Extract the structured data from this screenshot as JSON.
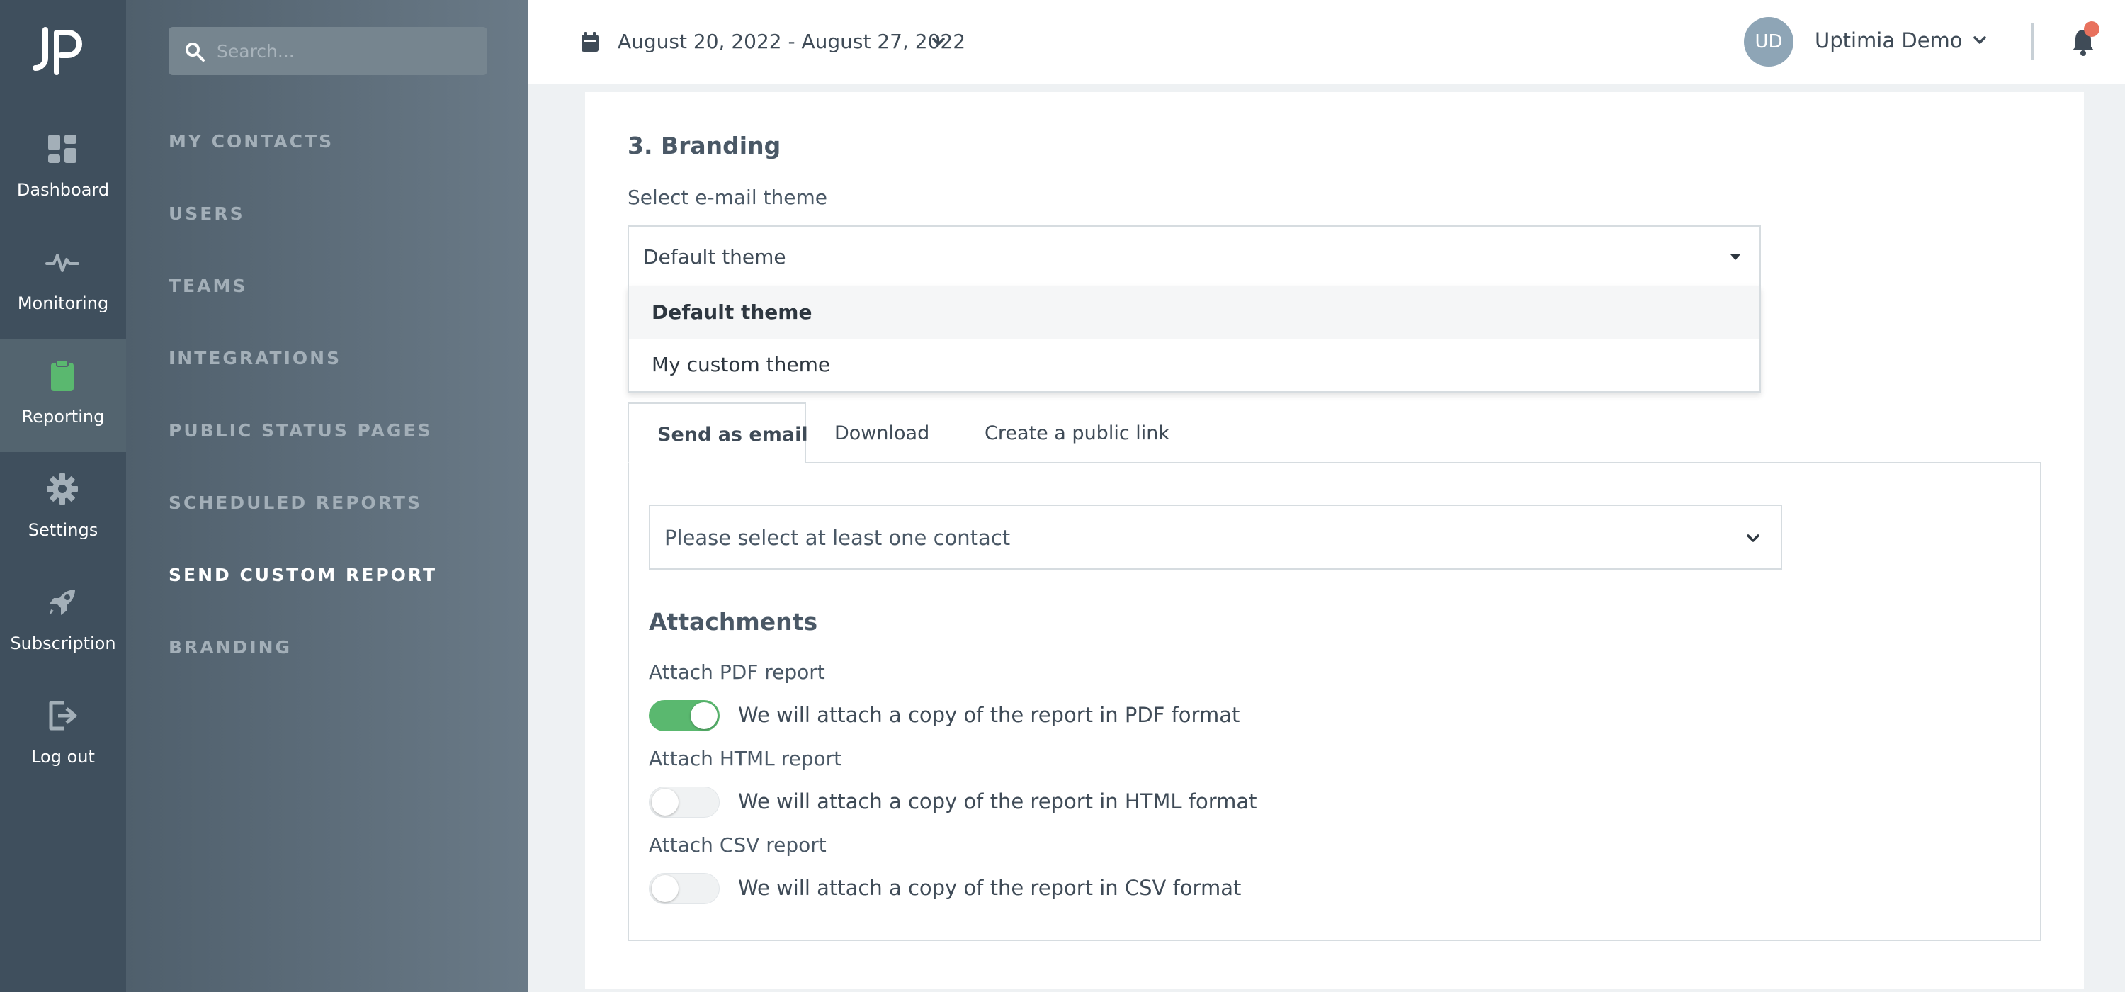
{
  "rail": {
    "items": [
      {
        "label": "Dashboard",
        "icon": "dashboard-icon"
      },
      {
        "label": "Monitoring",
        "icon": "pulse-icon"
      },
      {
        "label": "Reporting",
        "icon": "clipboard-icon",
        "active": true
      },
      {
        "label": "Settings",
        "icon": "gear-icon"
      },
      {
        "label": "Subscription",
        "icon": "rocket-icon"
      },
      {
        "label": "Log out",
        "icon": "logout-icon"
      }
    ]
  },
  "sidebar": {
    "search_placeholder": "Search...",
    "items": [
      {
        "label": "MY CONTACTS"
      },
      {
        "label": "USERS"
      },
      {
        "label": "TEAMS"
      },
      {
        "label": "INTEGRATIONS"
      },
      {
        "label": "PUBLIC STATUS PAGES"
      },
      {
        "label": "SCHEDULED REPORTS"
      },
      {
        "label": "SEND CUSTOM REPORT",
        "active": true
      },
      {
        "label": "BRANDING"
      }
    ]
  },
  "header": {
    "date_range": "August 20, 2022 - August 27, 2022",
    "avatar_initials": "UD",
    "user_name": "Uptimia Demo"
  },
  "branding": {
    "title": "3. Branding",
    "theme_label": "Select e-mail theme",
    "theme_selected": "Default theme",
    "theme_options": [
      "Default theme",
      "My custom theme"
    ]
  },
  "delivery": {
    "tabs": [
      "Send as email",
      "Download",
      "Create a public link"
    ],
    "active_tab": "Send as email",
    "contact_placeholder": "Please select at least one contact"
  },
  "attachments": {
    "title": "Attachments",
    "items": [
      {
        "label": "Attach PDF report",
        "description": "We will attach a copy of the report in PDF format",
        "enabled": true
      },
      {
        "label": "Attach HTML report",
        "description": "We will attach a copy of the report in HTML format",
        "enabled": false
      },
      {
        "label": "Attach CSV report",
        "description": "We will attach a copy of the report in CSV format",
        "enabled": false
      }
    ]
  },
  "colors": {
    "rail_bg": "#3f4f5d",
    "accent_green": "#5ab86f",
    "notification_dot": "#e8715d"
  }
}
